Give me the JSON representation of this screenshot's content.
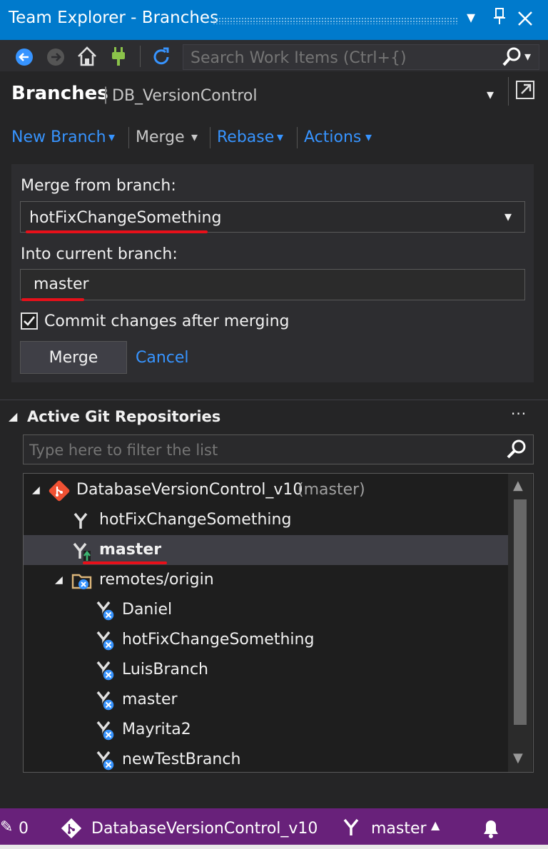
{
  "window": {
    "title": "Team Explorer - Branches"
  },
  "toolbar": {
    "search_placeholder": "Search Work Items (Ctrl+{)"
  },
  "header": {
    "title": "Branches",
    "repo": "DB_VersionControl"
  },
  "actions": {
    "new_branch": "New Branch",
    "merge": "Merge",
    "rebase": "Rebase",
    "actions": "Actions"
  },
  "merge_panel": {
    "from_label": "Merge from branch:",
    "from_value": "hotFixChangeSomething",
    "into_label": "Into current branch:",
    "into_value": "master",
    "commit_checkbox_label": "Commit changes after merging",
    "commit_checked": true,
    "merge_button": "Merge",
    "cancel_link": "Cancel"
  },
  "repositories": {
    "section_title": "Active Git Repositories",
    "more_label": "···",
    "filter_placeholder": "Type here to filter the list",
    "repo_name": "DatabaseVersionControl_v10",
    "repo_branch": "(master)",
    "local_branches": [
      "hotFixChangeSomething",
      "master"
    ],
    "remotes_folder": "remotes/origin",
    "remote_branches": [
      "Daniel",
      "hotFixChangeSomething",
      "LuisBranch",
      "master",
      "Mayrita2",
      "newTestBranch"
    ]
  },
  "statusbar": {
    "changes_count": "0",
    "repo": "DatabaseVersionControl_v10",
    "branch": "master"
  },
  "colors": {
    "accent": "#007acc",
    "status": "#68217a",
    "link": "#3794ff",
    "underline": "#e8101a"
  }
}
